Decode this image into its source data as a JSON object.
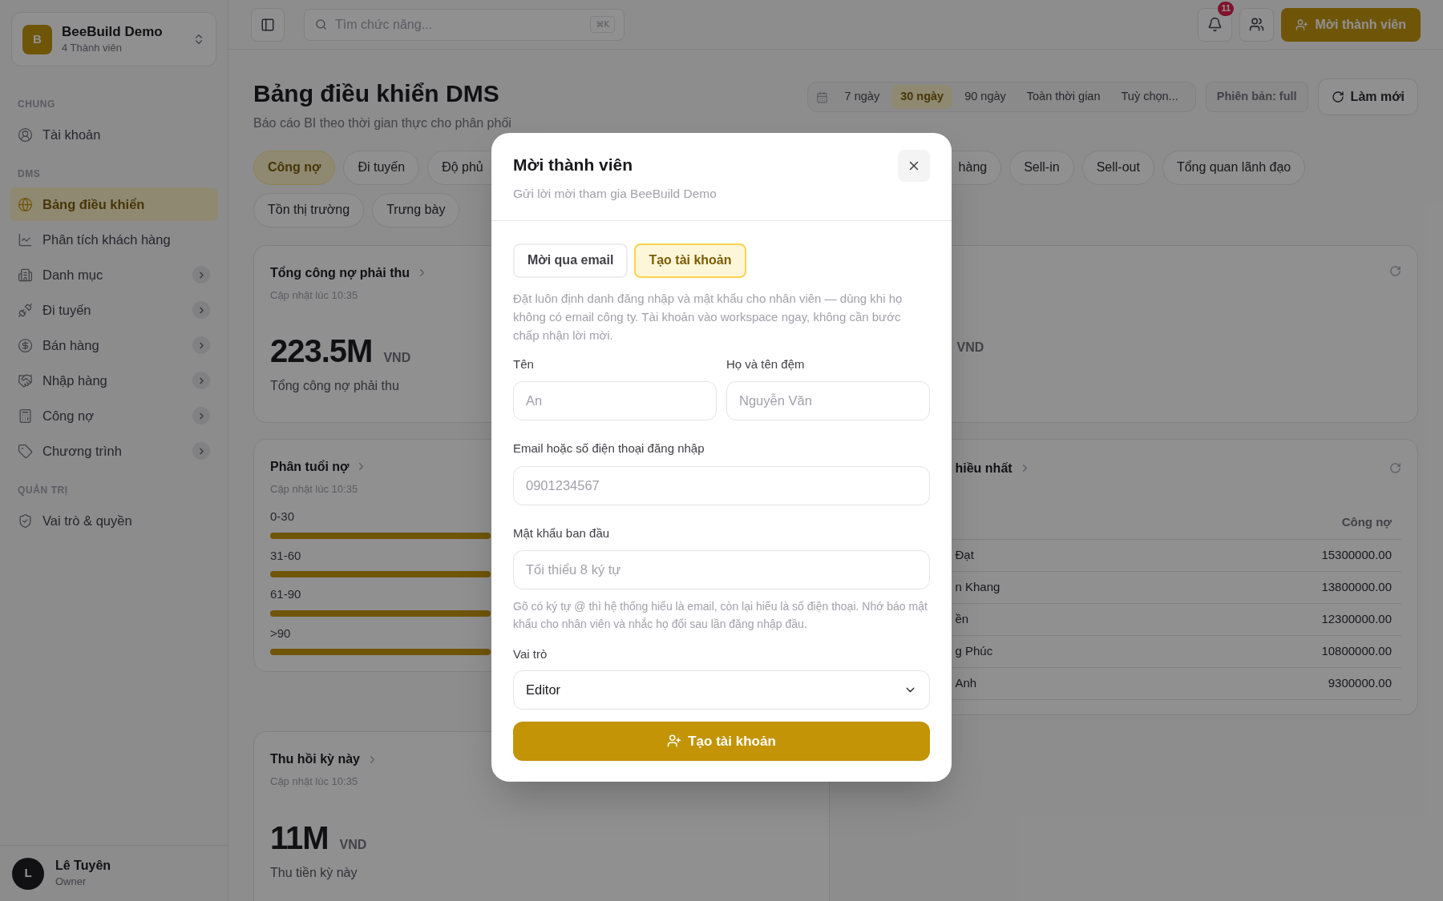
{
  "workspace": {
    "initial": "B",
    "name": "BeeBuild Demo",
    "members": "4 Thành viên"
  },
  "sidebar": {
    "sections": [
      {
        "label": "CHUNG",
        "items": [
          {
            "label": "Tài khoản",
            "selected": false,
            "expandable": false
          }
        ]
      },
      {
        "label": "DMS",
        "items": [
          {
            "label": "Bảng điều khiển",
            "selected": true,
            "expandable": false
          },
          {
            "label": "Phân tích khách hàng",
            "selected": false,
            "expandable": false
          },
          {
            "label": "Danh mục",
            "selected": false,
            "expandable": true
          },
          {
            "label": "Đi tuyến",
            "selected": false,
            "expandable": true
          },
          {
            "label": "Bán hàng",
            "selected": false,
            "expandable": true
          },
          {
            "label": "Nhập hàng",
            "selected": false,
            "expandable": true
          },
          {
            "label": "Công nợ",
            "selected": false,
            "expandable": true
          },
          {
            "label": "Chương trình",
            "selected": false,
            "expandable": true
          }
        ]
      },
      {
        "label": "QUẢN TRỊ",
        "items": [
          {
            "label": "Vai trò & quyền",
            "selected": false,
            "expandable": false
          }
        ]
      }
    ]
  },
  "user": {
    "initial": "L",
    "name": "Lê Tuyên",
    "role": "Owner"
  },
  "topbar": {
    "search_placeholder": "Tìm chức năng...",
    "shortcut": "⌘K",
    "notification_count": "11",
    "invite_button": "Mời thành viên"
  },
  "header": {
    "title": "Bảng điều khiển DMS",
    "subtitle": "Báo cáo BI theo thời gian thực cho phân phối"
  },
  "date_ranges": [
    {
      "label": "7 ngày",
      "selected": false
    },
    {
      "label": "30 ngày",
      "selected": true
    },
    {
      "label": "90 ngày",
      "selected": false
    },
    {
      "label": "Toàn thời gian",
      "selected": false
    },
    {
      "label": "Tuỳ chọn...",
      "selected": false
    }
  ],
  "version": "Phiên bản: full",
  "refresh_button": "Làm mới",
  "tabs": [
    {
      "label": "Công nợ",
      "selected": true,
      "kind": "plain"
    },
    {
      "label": "Đi tuyến",
      "selected": false,
      "kind": "plain"
    },
    {
      "label": "Độ phủ",
      "selected": false,
      "kind": "headclipped"
    },
    {
      "label": "hàng",
      "selected": false,
      "kind": "tailclipped"
    },
    {
      "label": "Sell-in",
      "selected": false,
      "kind": "plain"
    },
    {
      "label": "Sell-out",
      "selected": false,
      "kind": "plain"
    },
    {
      "label": "Tổng quan lãnh đạo",
      "selected": false,
      "kind": "plain"
    },
    {
      "label": "Tồn thị trường",
      "selected": false,
      "kind": "plain"
    },
    {
      "label": "Trưng bày",
      "selected": false,
      "kind": "plain"
    }
  ],
  "cards": [
    {
      "kind": "metric",
      "title": "Tổng công nợ phải thu",
      "updated": "Cập nhật lúc 10:35",
      "value": "223.5M",
      "unit": "VND",
      "caption": "Tổng công nợ phải thu"
    },
    {
      "kind": "stub",
      "unit": "VND"
    },
    {
      "kind": "aging",
      "title": "Phân tuổi nợ",
      "updated": "Cập nhật lúc 10:35",
      "buckets": [
        "0-30",
        "31-60",
        "61-90",
        ">90"
      ]
    },
    {
      "kind": "ranking",
      "title": "hiều nhất",
      "column": "Công nợ",
      "rows": [
        {
          "name": "Đạt",
          "amount": "15300000.00"
        },
        {
          "name": "n Khang",
          "amount": "13800000.00"
        },
        {
          "name": "ền",
          "amount": "12300000.00"
        },
        {
          "name": "g Phúc",
          "amount": "10800000.00"
        },
        {
          "name": "Anh",
          "amount": "9300000.00"
        }
      ]
    },
    {
      "kind": "metric",
      "title": "Thu hồi kỳ này",
      "updated": "Cập nhật lúc 10:35",
      "value": "11M",
      "unit": "VND",
      "caption": "Thu tiền kỳ này"
    }
  ],
  "dialog": {
    "title": "Mời thành viên",
    "subtitle": "Gửi lời mời tham gia BeeBuild Demo",
    "modes": [
      {
        "label": "Mời qua email",
        "selected": false
      },
      {
        "label": "Tạo tài khoản",
        "selected": true
      }
    ],
    "description": "Đặt luôn định danh đăng nhập và mật khẩu cho nhân viên — dùng khi họ không có email công ty. Tài khoản vào workspace ngay, không cần bước chấp nhận lời mời.",
    "fields": [
      {
        "label": "Tên",
        "placeholder": "An"
      },
      {
        "label": "Họ và tên đệm",
        "placeholder": "Nguyễn Văn"
      },
      {
        "label": "Email hoặc số điện thoại đăng nhập",
        "placeholder": "0901234567"
      },
      {
        "label": "Mật khẩu ban đầu",
        "placeholder": "Tối thiểu 8 ký tự"
      }
    ],
    "hint": "Gõ có ký tự @ thì hệ thống hiểu là email, còn lại hiểu là số điện thoại. Nhớ báo mật khẩu cho nhân viên và nhắc họ đổi sau lần đăng nhập đầu.",
    "role": {
      "label": "Vai trò",
      "value": "Editor"
    },
    "submit": "Tạo tài khoản"
  }
}
